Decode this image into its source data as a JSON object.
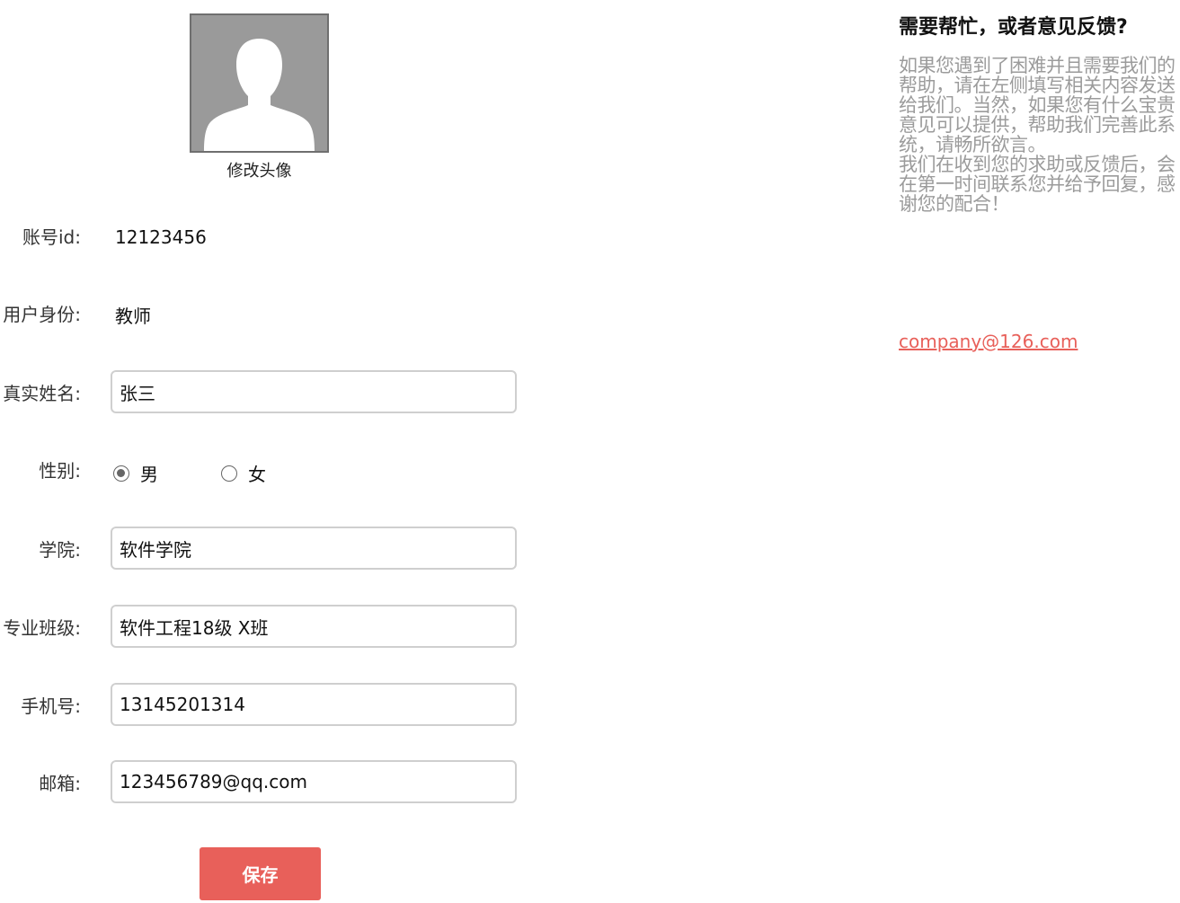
{
  "avatar": {
    "caption": "修改头像"
  },
  "form": {
    "account_id": {
      "label": "账号id:",
      "value": "12123456"
    },
    "identity": {
      "label": "用户身份:",
      "value": "教师"
    },
    "real_name": {
      "label": "真实姓名:",
      "value": "张三"
    },
    "gender": {
      "label": "性别:",
      "options": [
        "男",
        "女"
      ],
      "selected": "男"
    },
    "college": {
      "label": "学院:",
      "value": "软件学院"
    },
    "class": {
      "label": "专业班级:",
      "value": "软件工程18级 X班"
    },
    "phone": {
      "label": "手机号:",
      "value": "13145201314"
    },
    "email": {
      "label": "邮箱:",
      "value": "123456789@qq.com"
    },
    "save_label": "保存"
  },
  "help": {
    "title": "需要帮忙，或者意见反馈?",
    "paragraph1": "如果您遇到了困难并且需要我们的帮助，请在左侧填写相关内容发送给我们。当然，如果您有什么宝贵意见可以提供，帮助我们完善此系统，请畅所欲言。",
    "paragraph2": "我们在收到您的求助或反馈后，会在第一时间联系您并给予回复，感谢您的配合！",
    "contact_email": "company@126.com"
  },
  "colors": {
    "accent": "#e8605a",
    "help_text": "#9b9b9b",
    "avatar_bg": "#9a9a9a"
  }
}
